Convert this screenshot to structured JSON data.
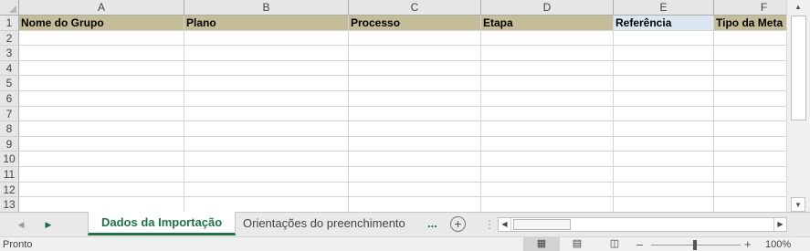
{
  "spreadsheet": {
    "columns": [
      "A",
      "B",
      "C",
      "D",
      "E",
      "F"
    ],
    "rows": [
      "1",
      "2",
      "3",
      "4",
      "5",
      "6",
      "7",
      "8",
      "9",
      "10",
      "11",
      "12",
      "13"
    ],
    "header_row": [
      "Nome do Grupo",
      "Plano",
      "Processo",
      "Etapa",
      "Referência",
      "Tipo da Meta"
    ],
    "selected_cell": "E1",
    "colors": {
      "header_fill": "#c4bd97",
      "selected_header_fill": "#dce6f1",
      "accent": "#217346"
    }
  },
  "sheet_tabs": {
    "active": "Dados da Importação",
    "other": "Orientações do preenchimento",
    "more": "...",
    "add_icon": "plus-circle-icon"
  },
  "status_bar": {
    "status": "Pronto",
    "zoom": "100%",
    "zoom_minus": "–",
    "zoom_plus": "+"
  }
}
